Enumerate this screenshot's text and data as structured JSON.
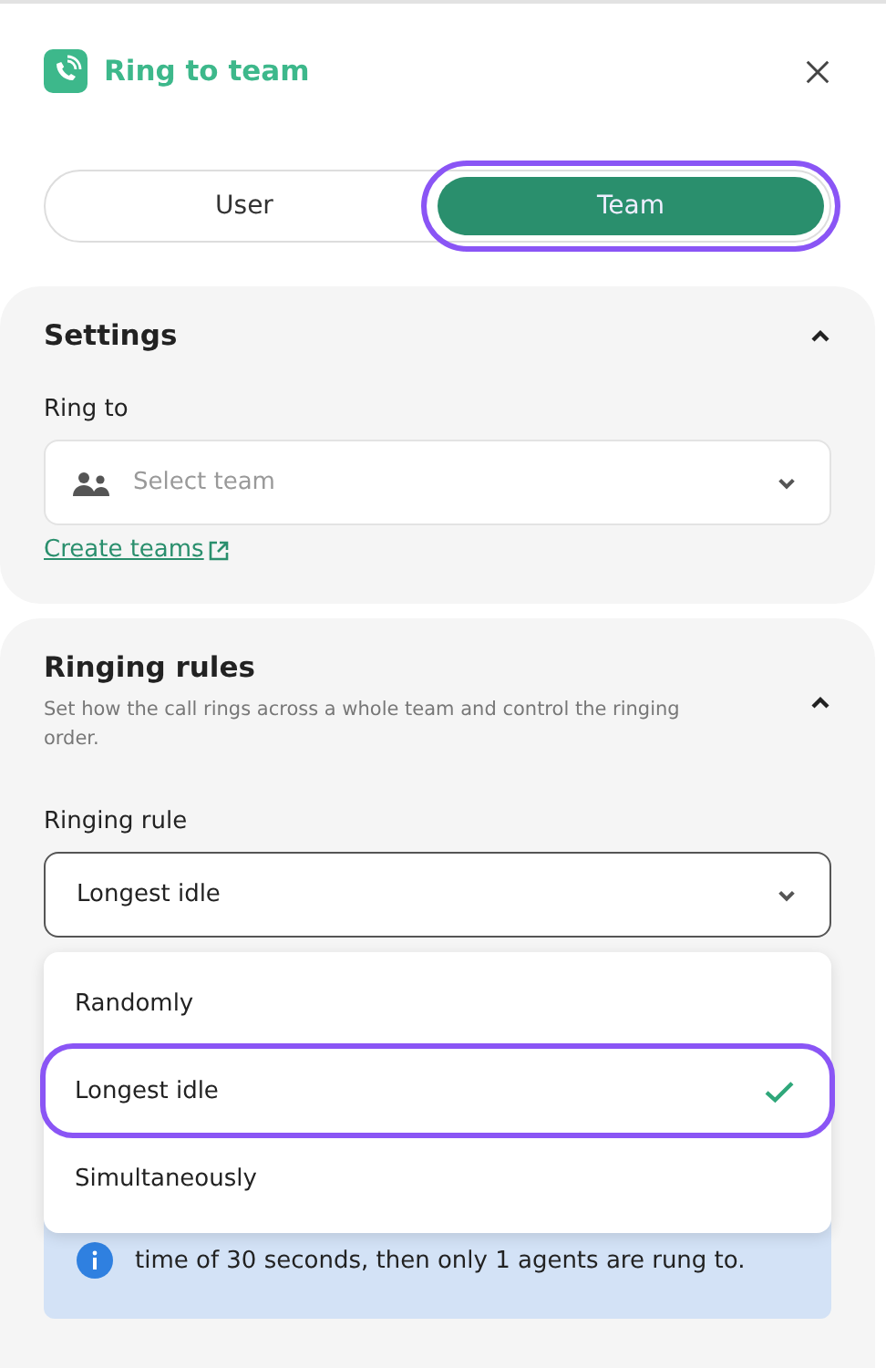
{
  "header": {
    "title": "Ring to team"
  },
  "mode_tabs": [
    {
      "label": "User",
      "selected": false,
      "highlighted": false
    },
    {
      "label": "Team",
      "selected": true,
      "highlighted": true
    }
  ],
  "settings": {
    "title": "Settings",
    "expanded": true,
    "field_label": "Ring to",
    "select": {
      "placeholder": "Select team"
    },
    "link": "Create teams"
  },
  "ringing_rules": {
    "title": "Ringing rules",
    "expanded": true,
    "description": "Set how the call rings across a whole team and control the ringing order.",
    "field_label": "Ringing rule",
    "select": {
      "value": "Longest idle"
    },
    "options": [
      {
        "label": "Randomly",
        "selected": false,
        "highlighted": false
      },
      {
        "label": "Longest idle",
        "selected": true,
        "highlighted": true
      },
      {
        "label": "Simultaneously",
        "selected": false,
        "highlighted": false
      }
    ],
    "info": "time of 30 seconds, then only 1 agents are rung to."
  }
}
